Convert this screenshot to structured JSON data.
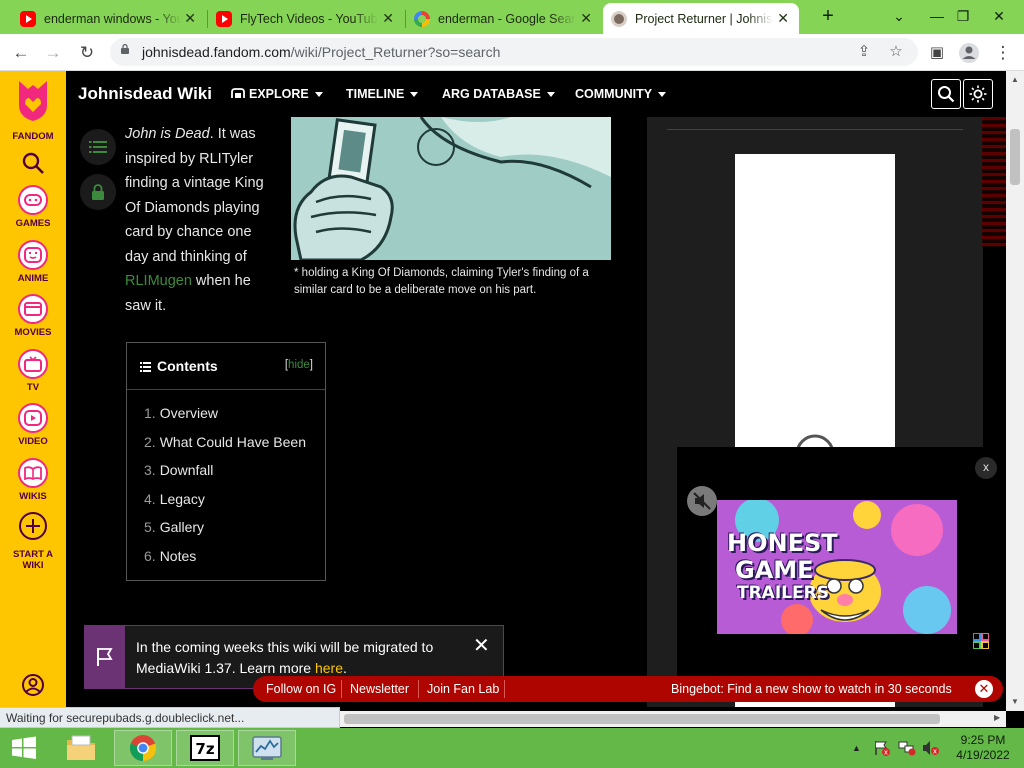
{
  "browser": {
    "tabs": [
      {
        "title": "enderman windows - YouTube",
        "favicon": "youtube-icon",
        "active": false
      },
      {
        "title": "FlyTech Videos - YouTube",
        "favicon": "youtube-icon",
        "active": false
      },
      {
        "title": "enderman - Google Search",
        "favicon": "google-icon",
        "active": false
      },
      {
        "title": "Project Returner | Johnisdead Wiki",
        "favicon": "fandom-wiki-icon",
        "active": true
      }
    ],
    "new_tab": "+",
    "url_host": "johnisdead.fandom.com",
    "url_path": "/wiki/Project_Returner?so=search"
  },
  "rail": {
    "brand": "FANDOM",
    "items": [
      {
        "label": "GAMES",
        "icon": "gamepad-icon"
      },
      {
        "label": "ANIME",
        "icon": "anime-face-icon"
      },
      {
        "label": "MOVIES",
        "icon": "film-icon"
      },
      {
        "label": "TV",
        "icon": "tv-icon"
      },
      {
        "label": "VIDEO",
        "icon": "play-icon"
      },
      {
        "label": "WIKIS",
        "icon": "book-icon"
      }
    ],
    "start_wiki": "START A WIKI"
  },
  "wiki": {
    "name": "Johnisdead Wiki",
    "nav": [
      "EXPLORE",
      "TIMELINE",
      "ARG DATABASE",
      "COMMUNITY"
    ]
  },
  "article": {
    "intro_em": "John is Dead",
    "intro_1": ". It was inspired by RLITyler finding a vintage King Of Diamonds playing card by chance one day and thinking of ",
    "intro_link": "RLIMugen",
    "intro_2": " when he saw it.",
    "caption": "* holding a King Of Diamonds, claiming Tyler's finding of a similar card to be a deliberate move on his part."
  },
  "toc": {
    "title": "Contents",
    "hide_label": "hide",
    "items": [
      {
        "num": "1.",
        "label": "Overview"
      },
      {
        "num": "2.",
        "label": "What Could Have Been"
      },
      {
        "num": "3.",
        "label": "Downfall"
      },
      {
        "num": "4.",
        "label": "Legacy"
      },
      {
        "num": "5.",
        "label": "Gallery"
      },
      {
        "num": "6.",
        "label": "Notes"
      }
    ]
  },
  "video": {
    "close": "x",
    "thumb_line1": "HONEST",
    "thumb_line2": "GAME",
    "thumb_line3": "TRAILERS"
  },
  "migration": {
    "text": "In the coming weeks this wiki will be migrated to MediaWiki 1.37. Learn more ",
    "link": "here",
    "end": "."
  },
  "promo": {
    "links": [
      "Follow on IG",
      "Newsletter",
      "Join Fan Lab"
    ],
    "bingebot": "Bingebot: Find a new show to watch in 30 seconds"
  },
  "status": "Waiting for securepubads.g.doubleclick.net...",
  "taskbar": {
    "time": "9:25 PM",
    "date": "4/19/2022"
  },
  "colors": {
    "fandom_yellow": "#fec600",
    "fandom_pink": "#f2287f",
    "link_green": "#3c8b3c",
    "promo_red": "#ae0500",
    "tab_strip": "#86d455",
    "taskbar": "#63b847"
  }
}
